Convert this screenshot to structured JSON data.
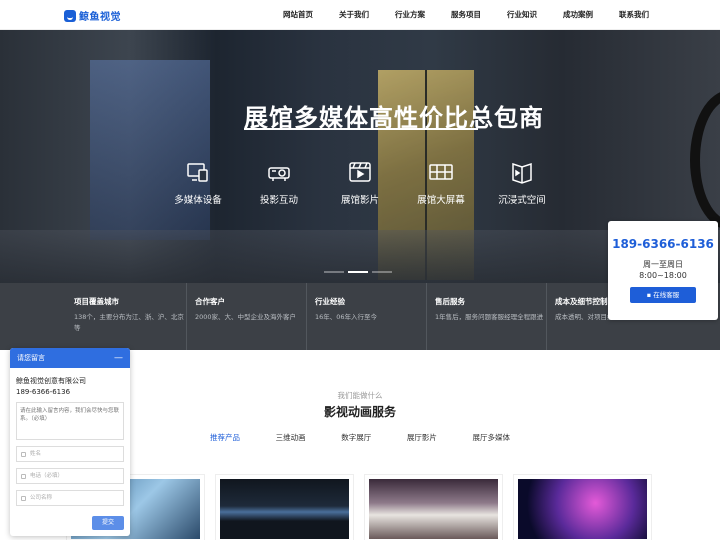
{
  "header": {
    "logo_text": "鲸鱼视觉",
    "nav": [
      "网站首页",
      "关于我们",
      "行业方案",
      "服务项目",
      "行业知识",
      "成功案例",
      "联系我们"
    ]
  },
  "hero": {
    "title": "展馆多媒体高性价比总包商",
    "services": [
      {
        "label": "多媒体设备",
        "icon": "devices-icon"
      },
      {
        "label": "投影互动",
        "icon": "projector-icon"
      },
      {
        "label": "展馆影片",
        "icon": "film-icon"
      },
      {
        "label": "展馆大屏幕",
        "icon": "large-screen-icon"
      },
      {
        "label": "沉浸式空间",
        "icon": "immersive-space-icon"
      }
    ],
    "active_slide": 2
  },
  "stats": [
    {
      "title": "项目覆盖城市",
      "desc": "138个，主要分布为江、浙、沪、北京等"
    },
    {
      "title": "合作客户",
      "desc": "2000家、大、中型企业及海外客户"
    },
    {
      "title": "行业经验",
      "desc": "16年、06年入行至今"
    },
    {
      "title": "售后服务",
      "desc": "1年售后，服务问题客服经理全程跟进"
    },
    {
      "title": "成本及细节控制",
      "desc": "成本透明、对项目细节严格杜绝粗糙。"
    }
  ],
  "hotline": {
    "phone": "189-6366-6136",
    "days": "周一至周日",
    "hours": "8:00~18:00",
    "button": "在线客服"
  },
  "section": {
    "subtitle": "我们能做什么",
    "title": "影视动画服务",
    "tabs": [
      "推荐产品",
      "三维动画",
      "数字展厅",
      "展厅影片",
      "展厅多媒体"
    ],
    "active_tab": 0
  },
  "chat": {
    "title": "请您留言",
    "company": "鲸鱼视觉创意有限公司",
    "phone": "189-6366-6136",
    "message_placeholder": "请在此输入留言内容，我们会尽快与您联系。（必填）",
    "name_placeholder": "姓名",
    "tel_placeholder": "电话（必填）",
    "company_placeholder": "公司名称",
    "submit": "提交"
  },
  "colors": {
    "accent": "#1e5ed8",
    "stats_bg": "#3c4046"
  }
}
